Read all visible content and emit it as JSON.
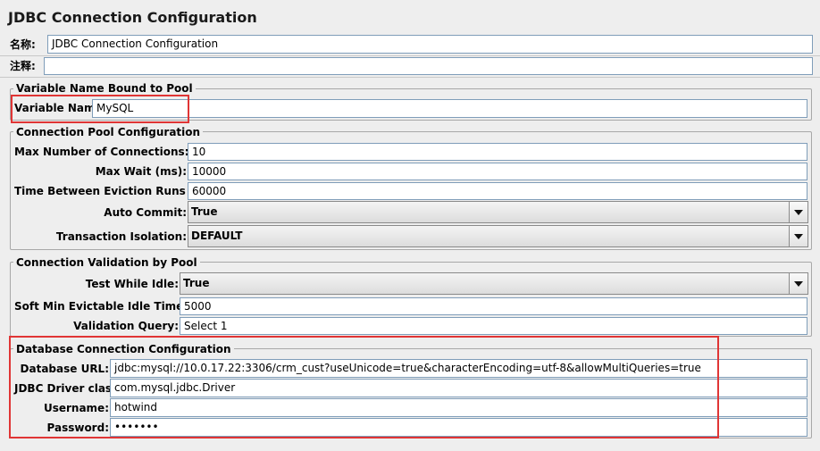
{
  "page": {
    "title": "JDBC Connection Configuration",
    "name_label": "名称:",
    "name_value": "JDBC Connection Configuration",
    "comment_label": "注释:",
    "comment_value": ""
  },
  "variable_group": {
    "legend": "Variable Name Bound to Pool",
    "var_label": "Variable Name:",
    "var_value": "MySQL"
  },
  "pool_group": {
    "legend": "Connection Pool Configuration",
    "max_conn_label": "Max Number of Connections:",
    "max_conn_value": "10",
    "max_wait_label": "Max Wait (ms):",
    "max_wait_value": "10000",
    "eviction_label": "Time Between Eviction Runs (ms):",
    "eviction_value": "60000",
    "auto_commit_label": "Auto Commit:",
    "auto_commit_value": "True",
    "isolation_label": "Transaction Isolation:",
    "isolation_value": "DEFAULT"
  },
  "validation_group": {
    "legend": "Connection Validation by Pool",
    "test_idle_label": "Test While Idle:",
    "test_idle_value": "True",
    "soft_min_label": "Soft Min Evictable Idle Time(ms):",
    "soft_min_value": "5000",
    "query_label": "Validation Query:",
    "query_value": "Select 1"
  },
  "db_group": {
    "legend": "Database Connection Configuration",
    "url_label": "Database URL:",
    "url_value": "jdbc:mysql://10.0.17.22:3306/crm_cust?useUnicode=true&characterEncoding=utf-8&allowMultiQueries=true",
    "driver_label": "JDBC Driver class:",
    "driver_value": "com.mysql.jdbc.Driver",
    "user_label": "Username:",
    "user_value": "hotwind",
    "pass_label": "Password:",
    "pass_value": "•••••••"
  },
  "colors": {
    "highlight": "#e03535",
    "field_border": "#7f9db9",
    "background": "#eeeeee"
  }
}
